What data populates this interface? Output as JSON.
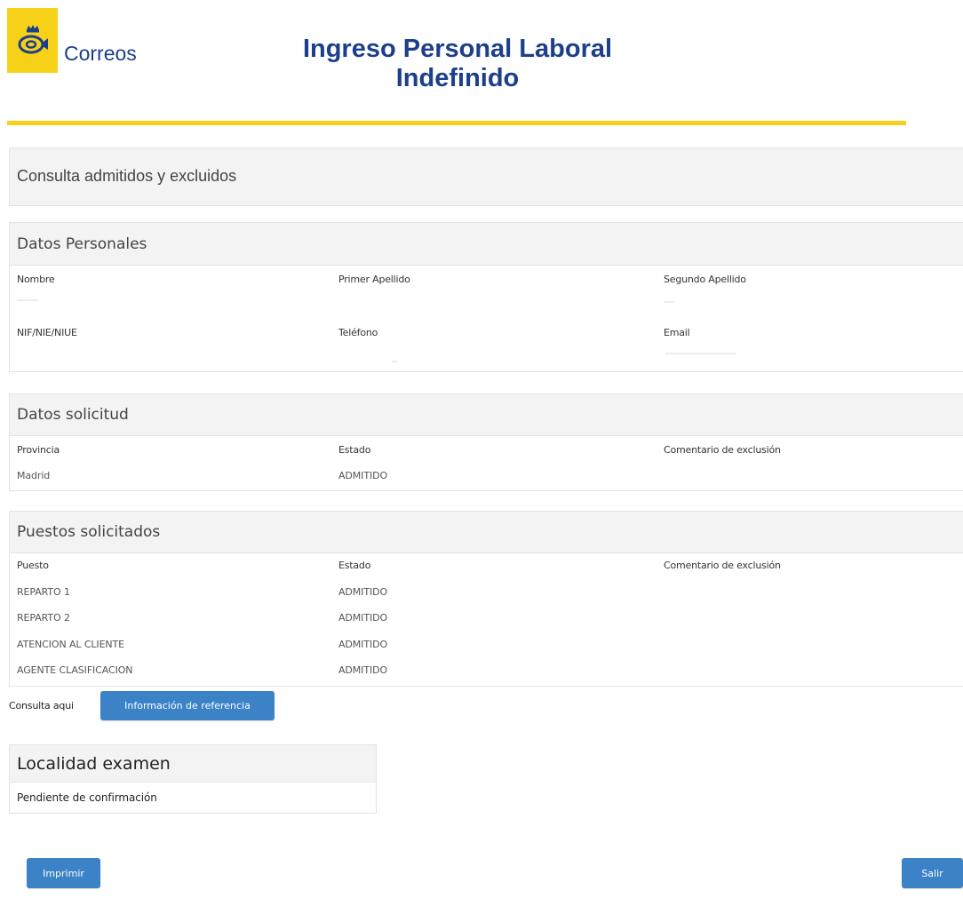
{
  "header": {
    "logo_text": "Correos",
    "title_line1": "Ingreso Personal Laboral",
    "title_line2": "Indefinido",
    "brand_yellow": "#f7d117",
    "brand_blue": "#1c3f8c",
    "logo_icon": "post-horn-crown-icon"
  },
  "consulta": {
    "title": "Consulta admitidos y excluidos"
  },
  "datos_personales": {
    "title": "Datos Personales",
    "labels": {
      "nombre": "Nombre",
      "primer_apellido": "Primer Apellido",
      "segundo_apellido": "Segundo Apellido",
      "nif": "NIF/NIE/NIUE",
      "telefono": "Teléfono",
      "email": "Email"
    }
  },
  "datos_solicitud": {
    "title": "Datos solicitud",
    "labels": {
      "provincia": "Provincia",
      "estado": "Estado",
      "comentario": "Comentario de exclusión"
    },
    "values": {
      "provincia": "Madrid",
      "estado": "ADMITIDO"
    }
  },
  "puestos": {
    "title": "Puestos solicitados",
    "columns": [
      "Puesto",
      "Estado",
      "Comentario de exclusión"
    ],
    "rows": [
      {
        "puesto": "REPARTO 1",
        "estado": "ADMITIDO"
      },
      {
        "puesto": "REPARTO 2",
        "estado": "ADMITIDO"
      },
      {
        "puesto": "ATENCION AL CLIENTE",
        "estado": "ADMITIDO"
      },
      {
        "puesto": "AGENTE CLASIFICACION",
        "estado": "ADMITIDO"
      }
    ]
  },
  "referencia": {
    "label": "Consulta aqui",
    "button": "Información de referencia"
  },
  "localidad": {
    "title": "Localidad examen",
    "value": "Pendiente de confirmación"
  },
  "actions": {
    "print": "Imprimir",
    "exit": "Salir",
    "button_color": "#3b83c6"
  }
}
